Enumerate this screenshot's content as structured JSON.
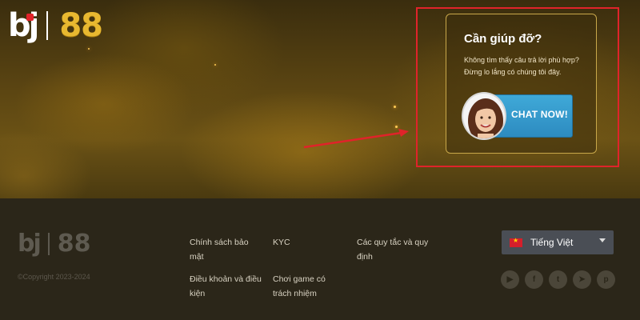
{
  "brand": {
    "logo_left": "bj",
    "logo_right": "88"
  },
  "help": {
    "title": "Cần giúp đỡ?",
    "line1": "Không tìm thấy câu trả lời phù hợp?",
    "line2": "Đừng lo lắng có chúng tôi đây.",
    "chat_label": "CHAT NOW!"
  },
  "footer": {
    "copyright": "©Copyright 2023-2024",
    "links": {
      "privacy": "Chính sách bảo mật",
      "kyc": "KYC",
      "rules": "Các quy tắc và quy định",
      "terms": "Điều khoản và điều kiện",
      "responsible": "Chơi game có trách nhiệm"
    },
    "language": "Tiếng Việt",
    "socials": [
      "youtube-icon",
      "facebook-icon",
      "twitter-icon",
      "telegram-icon",
      "pinterest-icon"
    ]
  },
  "colors": {
    "accent_gold": "#e8b830",
    "highlight_red": "#e0232a",
    "chat_blue": "#3fa9d8",
    "footer_bg": "#2b2619"
  }
}
